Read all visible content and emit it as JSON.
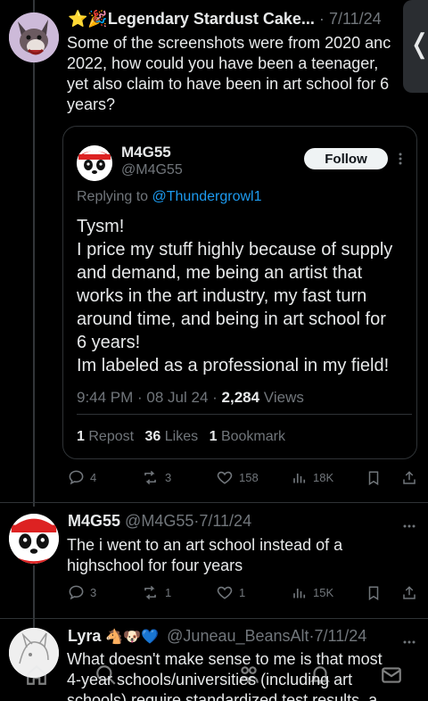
{
  "tweet1": {
    "name": "⭐🎉Legendary Stardust Cake...",
    "sep": "·",
    "date": "7/11/24",
    "text_lines": [
      "Some of the screenshots were from 2020 anc",
      "2022, how could you have been a teenager,",
      "yet also claim to have been in art school for 6",
      "years?"
    ],
    "actions": {
      "replies": "4",
      "reposts": "3",
      "likes": "158",
      "views": "18K"
    }
  },
  "quote": {
    "name": "M4G55",
    "handle": "@M4G55",
    "follow_label": "Follow",
    "replying_prefix": "Replying to ",
    "replying_handle": "@Thundergrowl1",
    "text_lines": [
      "Tysm!",
      "I price my stuff highly because of supply",
      "and demand, me being an artist that",
      "works in the art industry, my fast turn",
      "around time, and being in art school for",
      "6 years!",
      "Im labeled as a professional in my field!"
    ],
    "time": "9:44 PM · 08 Jul 24 · ",
    "views_count": "2,284",
    "views_label": " Views",
    "stats": {
      "reposts_count": "1",
      "reposts_label": "Repost",
      "likes_count": "36",
      "likes_label": "Likes",
      "bookmarks_count": "1",
      "bookmarks_label": "Bookmark"
    }
  },
  "tweet2": {
    "name": "M4G55",
    "handle": "@M4G55",
    "sep": "·",
    "date": "7/11/24",
    "text_lines": [
      "The i went to an art school instead of a",
      "highschool for four years"
    ],
    "actions": {
      "replies": "3",
      "reposts": "1",
      "likes": "1",
      "views": "15K"
    }
  },
  "tweet3": {
    "name": "Lyra",
    "emojis": "🐴🐶💙",
    "handle": "@Juneau_BeansAlt",
    "sep": "·",
    "date": "7/11/24",
    "text_lines": [
      "What doesn't make sense to me is that most",
      "4-year schools/universities (including art",
      "schools) require standardized test results, a"
    ]
  },
  "back_glyph": "❬",
  "colors": {
    "background": "#000000",
    "text": "#e7e9ea",
    "muted": "#71767b",
    "link": "#1d9bf0",
    "border": "#2f3336"
  }
}
